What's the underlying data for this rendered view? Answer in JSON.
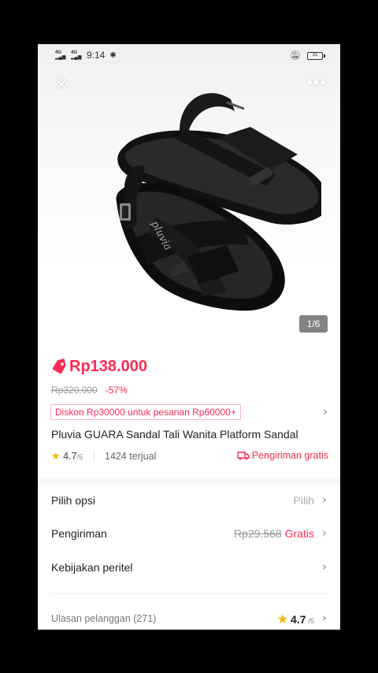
{
  "status_bar": {
    "sim1": "4G",
    "sim2": "4G",
    "time": "9:14",
    "battery": "31"
  },
  "gallery": {
    "counter": "1/6",
    "brand_insole_text": "pluvia"
  },
  "product": {
    "price": "Rp138.000",
    "original_price": "Rp320.000",
    "discount": "-57%",
    "promo": "Diskon Rp30000 untuk pesanan Rp60000+",
    "title": "Pluvia GUARA Sandal Tali Wanita Platform Sandal",
    "rating": "4.7",
    "rating_scale": "/5",
    "sold": "1424 terjual",
    "shipping_badge": "Pengiriman gratis"
  },
  "options": [
    {
      "label": "Pilih opsi",
      "value": "Pilih"
    },
    {
      "label": "Pengiriman",
      "old_value": "Rp29.568",
      "value": "Gratis"
    },
    {
      "label": "Kebijakan peritel"
    }
  ],
  "reviews": {
    "label": "Ulasan pelanggan (271)",
    "score": "4.7",
    "scale": "/5"
  },
  "colors": {
    "accent": "#fe2c55",
    "star": "#f7b500",
    "text": "#222222",
    "muted": "#999999"
  },
  "icons": [
    "close-icon",
    "more-icon",
    "price-tag-icon",
    "star-icon",
    "truck-icon",
    "chevron-right-icon",
    "gear-icon",
    "mute-icon",
    "battery-icon"
  ]
}
